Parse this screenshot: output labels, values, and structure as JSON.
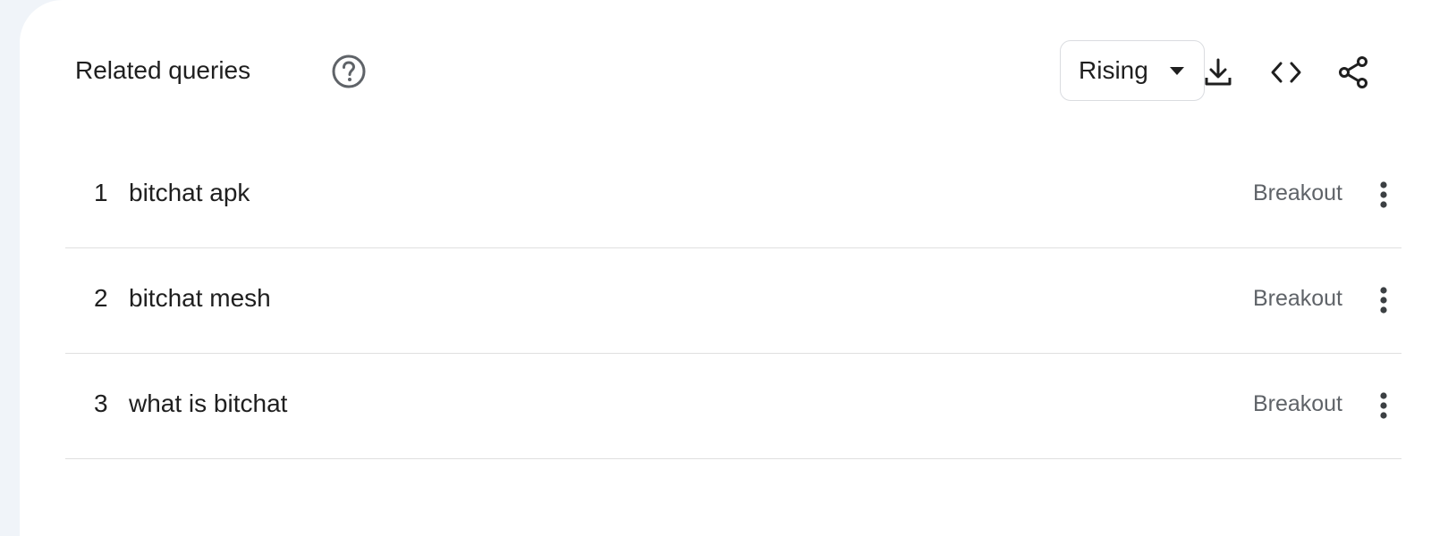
{
  "widget": {
    "title": "Related queries",
    "help_icon": "help-circle-icon",
    "filter": {
      "selected": "Rising",
      "icon": "caret-down-icon"
    },
    "toolbar": {
      "download_icon": "download-icon",
      "embed_icon": "code-icon",
      "share_icon": "share-icon"
    },
    "rows": [
      {
        "rank": "1",
        "query": "bitchat apk",
        "value": "Breakout"
      },
      {
        "rank": "2",
        "query": "bitchat mesh",
        "value": "Breakout"
      },
      {
        "rank": "3",
        "query": "what is bitchat",
        "value": "Breakout"
      }
    ],
    "colors": {
      "background": "#f0f4f9",
      "card": "#ffffff",
      "text": "#1f1f1f",
      "muted": "#5f6368",
      "divider": "#e0e0e0"
    }
  }
}
